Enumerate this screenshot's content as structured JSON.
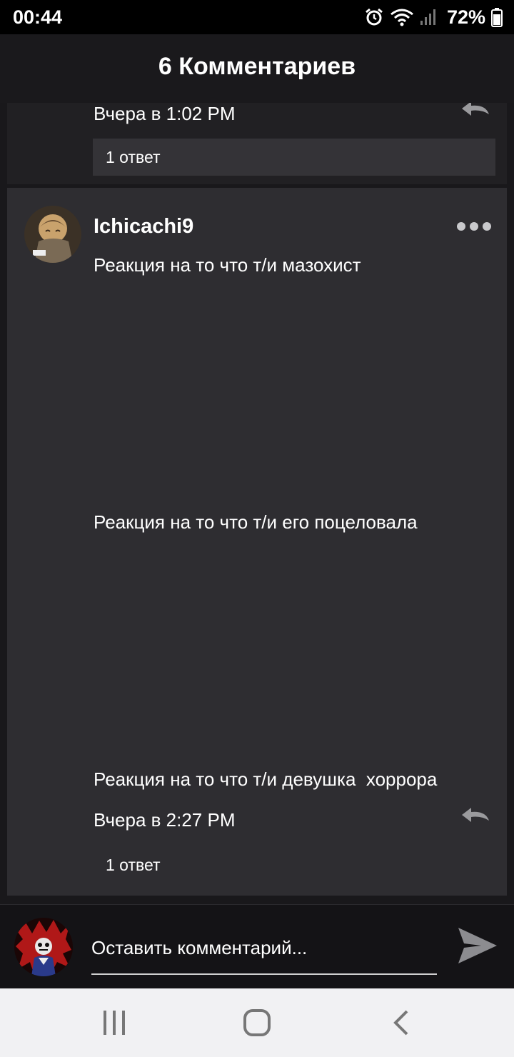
{
  "status_bar": {
    "time": "00:44",
    "battery": "72%",
    "icons": [
      "alarm-icon",
      "wifi-icon",
      "signal-icon",
      "battery-icon"
    ]
  },
  "header": {
    "title": "6 Комментариев"
  },
  "previous_comment": {
    "timestamp": "Вчера в 1:02 PM",
    "replies_label": "1 ответ"
  },
  "comment": {
    "username": "Ichicachi9",
    "lines": [
      "Реакция на то что т/и мазохист",
      "Реакция на то что т/и его поцеловала",
      "Реакция на то что т/и девушка  хоррора"
    ],
    "timestamp": "Вчера в 2:27 PM",
    "replies_label": "1 ответ"
  },
  "compose": {
    "placeholder": "Оставить комментарий..."
  },
  "colors": {
    "background": "#19181b",
    "card": "#2e2d31",
    "header": "#1a191c",
    "compose": "#141316",
    "nav": "#f1f1f3"
  }
}
